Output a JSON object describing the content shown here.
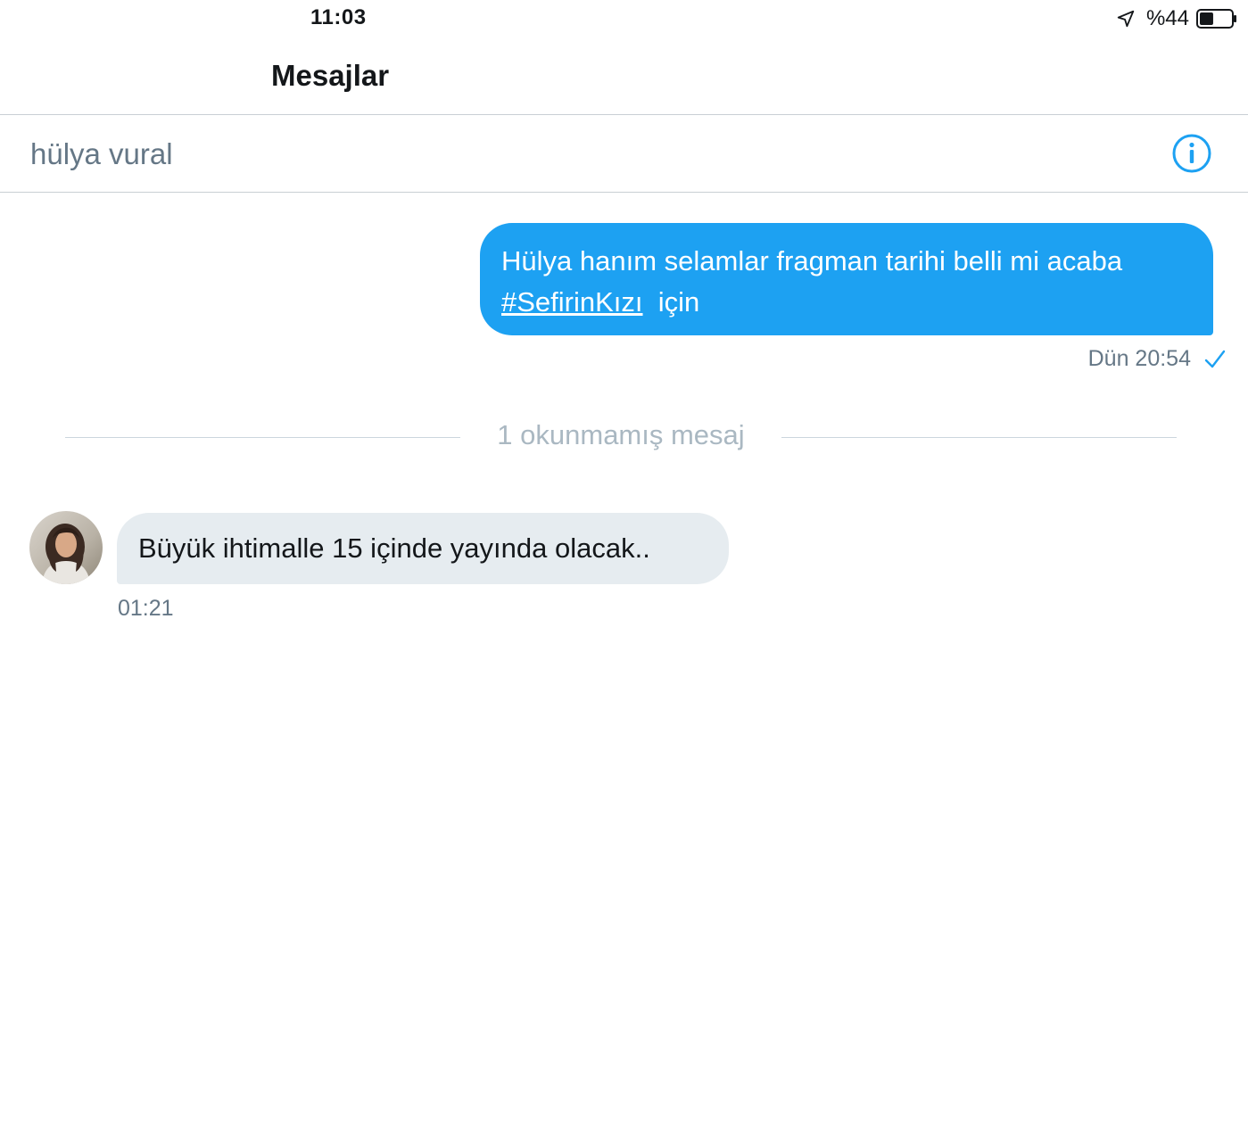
{
  "status_bar": {
    "time": "11:03",
    "battery_percent": "%44",
    "battery_level": 0.44,
    "location_icon": "location-arrow-icon"
  },
  "nav": {
    "title": "Mesajlar"
  },
  "conversation": {
    "name": "hülya vural",
    "info_icon": "info-icon"
  },
  "messages": {
    "outgoing": {
      "text_line1": "Hülya hanım selamlar fragman tarihi belli mi acaba",
      "hashtag": "#SefirinKızı",
      "text_after_hashtag": "için",
      "timestamp": "Dün 20:54",
      "status_icon": "check-icon"
    },
    "unread_divider": "1 okunmamış mesaj",
    "incoming": {
      "text": "Büyük ihtimalle  15 içinde yayında olacak..",
      "timestamp": "01:21",
      "avatar_icon": "avatar"
    }
  },
  "colors": {
    "accent": "#1da1f2",
    "incoming_bubble": "#e6ecf0",
    "secondary_text": "#657786",
    "divider_text": "#aab8c2"
  }
}
